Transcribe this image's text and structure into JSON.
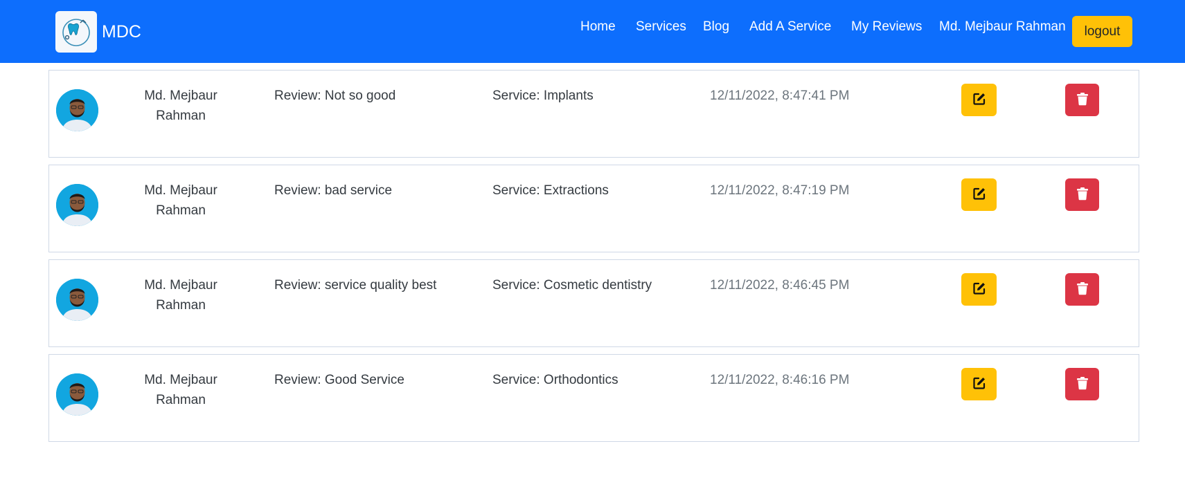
{
  "brand": {
    "name": "MDC",
    "logo_icon": "tooth-stethoscope-icon"
  },
  "nav": {
    "links": [
      "Home",
      "Services",
      "Blog",
      "Add A Service",
      "My Reviews"
    ],
    "user_name": "Md. Mejbaur Rahman",
    "logout_label": "logout"
  },
  "colors": {
    "navbar": "#0d6efd",
    "edit_button": "#ffc107",
    "delete_button": "#dc3545",
    "logout_button": "#ffc107"
  },
  "reviews": [
    {
      "name": "Md. Mejbaur Rahman",
      "review": "Review: Not so good",
      "service": "Service: Implants",
      "time": "12/11/2022, 8:47:41 PM",
      "edit_icon": "edit-icon",
      "delete_icon": "trash-icon"
    },
    {
      "name": "Md. Mejbaur Rahman",
      "review": "Review: bad service",
      "service": "Service: Extractions",
      "time": "12/11/2022, 8:47:19 PM",
      "edit_icon": "edit-icon",
      "delete_icon": "trash-icon"
    },
    {
      "name": "Md. Mejbaur Rahman",
      "review": "Review: service quality best",
      "service": "Service: Cosmetic dentistry",
      "time": "12/11/2022, 8:46:45 PM",
      "edit_icon": "edit-icon",
      "delete_icon": "trash-icon"
    },
    {
      "name": "Md. Mejbaur Rahman",
      "review": "Review: Good Service",
      "service": "Service: Orthodontics",
      "time": "12/11/2022, 8:46:16 PM",
      "edit_icon": "edit-icon",
      "delete_icon": "trash-icon"
    }
  ]
}
